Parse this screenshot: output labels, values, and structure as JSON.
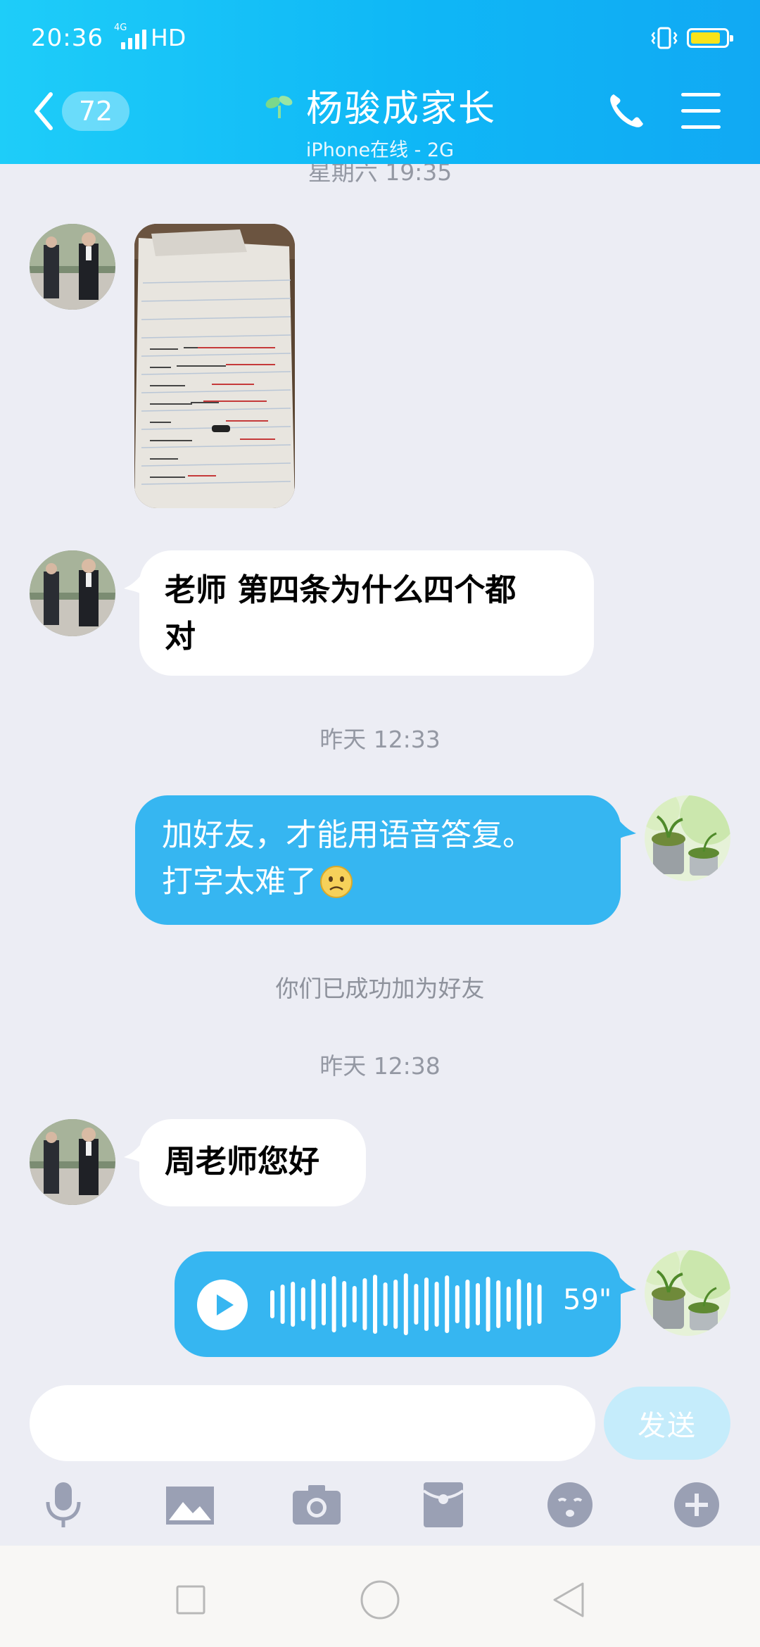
{
  "status_bar": {
    "time": "20:36",
    "network": "4G",
    "hd": "HD",
    "battery_level": 0.85
  },
  "header": {
    "unread_count": "72",
    "title": "杨骏成家长",
    "subtitle": "iPhone在线 - 2G"
  },
  "messages": {
    "cut_timestamp": "星期六 19:35",
    "photo": {
      "sender": "contact",
      "content": "photo of a handwritten notebook page"
    },
    "msg1": {
      "sender": "contact",
      "text_line1": "老师 第四条为什么四个都",
      "text_line2": "对"
    },
    "timestamp1": "昨天 12:33",
    "msg2": {
      "sender": "me",
      "text_line1": "加好友，才能用语音答复。",
      "text_line2": "打字太难了",
      "emoji": "frown-emoji"
    },
    "system_note": "你们已成功加为好友",
    "timestamp2": "昨天 12:38",
    "msg3": {
      "sender": "contact",
      "text": "周老师您好"
    },
    "voice": {
      "sender": "me",
      "duration": "59\""
    }
  },
  "composer": {
    "placeholder": "",
    "send_label": "发送"
  },
  "toolbar": {
    "items": [
      "microphone-icon",
      "image-icon",
      "camera-icon",
      "red-packet-icon",
      "emoji-icon",
      "plus-icon"
    ]
  },
  "navigation": {
    "items": [
      "recents-square",
      "home-circle",
      "back-triangle"
    ]
  },
  "colors": {
    "header_gradient_start": "#1ecdf9",
    "header_gradient_end": "#11a9f3",
    "outgoing_bubble": "#36b6f1",
    "incoming_bubble": "#ffffff",
    "chat_background": "#ecedf4",
    "send_button_disabled": "#c5ecfb",
    "toolbar_icon": "#9aa0b4"
  }
}
